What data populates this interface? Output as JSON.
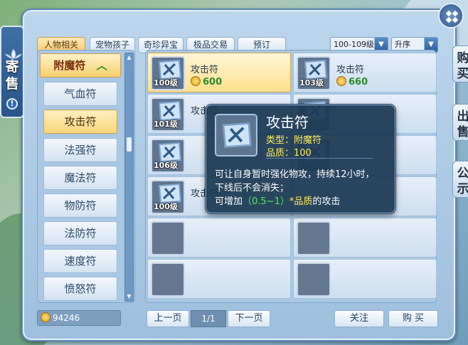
{
  "tabs": [
    "人物相关",
    "宠物孩子",
    "奇珍异宝",
    "极品交易",
    "预订"
  ],
  "filters": {
    "level": "100-109级",
    "sort": "升序"
  },
  "categories": {
    "header": "附魔符",
    "items": [
      "气血符",
      "攻击符",
      "法强符",
      "魔法符",
      "物防符",
      "法防符",
      "速度符",
      "愤怒符"
    ]
  },
  "items": [
    {
      "name": "攻击符",
      "level": "100级",
      "price": "600"
    },
    {
      "name": "攻击符",
      "level": "103级",
      "price": "660"
    },
    {
      "name": "攻击符",
      "level": "101级"
    },
    {
      "level": "106级"
    },
    {
      "name": "攻击符",
      "level": "100级"
    }
  ],
  "tooltip": {
    "title": "攻击符",
    "type_label": "类型：",
    "type_value": "附魔符",
    "quality_label": "品质：",
    "quality_value": "100",
    "desc_line1": "可让自身暂时强化物攻，持续12小时，",
    "desc_line2": "下线后不会消失；",
    "desc_prefix": "可增加",
    "desc_range": "（0.5~1）",
    "desc_quality": "*品质",
    "desc_suffix": "的攻击"
  },
  "wallet": {
    "balance": "94246"
  },
  "pagination": {
    "prev": "上一页",
    "page": "1/1",
    "next": "下一页"
  },
  "actions": {
    "follow": "关注",
    "buy": "购 买"
  },
  "side": {
    "char1": "寄",
    "char2": "售"
  },
  "right_tabs": [
    "购买",
    "出售",
    "公示"
  ],
  "colors": {
    "accent_gold": "#f7c86c",
    "panel_blue": "#9ebfdc",
    "price_green": "#2d8a2a"
  }
}
